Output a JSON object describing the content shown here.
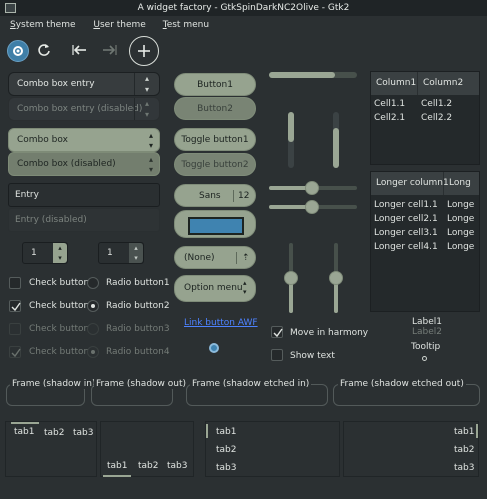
{
  "window": {
    "title": "A widget factory - GtkSpinDarkNC2Olive - Gtk2"
  },
  "menubar": {
    "items": [
      {
        "mnemonic": "S",
        "rest": "ystem theme"
      },
      {
        "mnemonic": "U",
        "rest": "ser theme"
      },
      {
        "mnemonic": "T",
        "rest": "est menu"
      }
    ]
  },
  "toolbar": {
    "icons": [
      "gear-icon",
      "refresh-icon",
      "back-arrow-icon",
      "forward-arrow-icon",
      "add-icon"
    ]
  },
  "combos": {
    "entry": "Combo box entry",
    "entry_disabled": "Combo box entry (disabled)",
    "box": "Combo box",
    "box_disabled": "Combo box (disabled)"
  },
  "entries": {
    "entry": "Entry",
    "entry_disabled": "Entry (disabled)"
  },
  "spins": {
    "spin1": "1",
    "spin2": "1"
  },
  "checks": [
    {
      "label": "Check button1",
      "checked": false,
      "disabled": false
    },
    {
      "label": "Check button2",
      "checked": true,
      "disabled": false
    },
    {
      "label": "Check button3",
      "checked": false,
      "disabled": true
    },
    {
      "label": "Check button4",
      "checked": true,
      "disabled": true
    }
  ],
  "radios": [
    {
      "label": "Radio button1",
      "selected": false,
      "disabled": false
    },
    {
      "label": "Radio button2",
      "selected": true,
      "disabled": false
    },
    {
      "label": "Radio button3",
      "selected": false,
      "disabled": true
    },
    {
      "label": "Radio button4",
      "selected": true,
      "disabled": true
    }
  ],
  "buttons": {
    "button1": "Button1",
    "button2": "Button2",
    "toggle1": "Toggle button1",
    "toggle2": "Toggle button2",
    "font_name": "Sans",
    "font_size": "12",
    "none": "(None)",
    "option_menu": "Option menu",
    "link": "Link button AWF"
  },
  "scales": {
    "move_in_harmony": "Move in harmony",
    "show_text": "Show text"
  },
  "tree1": {
    "columns": [
      "Column1",
      "Column2"
    ],
    "rows": [
      [
        "Cell1.1",
        "Cell1.2"
      ],
      [
        "Cell2.1",
        "Cell2.2"
      ]
    ]
  },
  "tree2": {
    "columns": [
      "Longer column1",
      "Long"
    ],
    "rows": [
      [
        "Longer cell1.1",
        "Longe"
      ],
      [
        "Longer cell2.1",
        "Longe"
      ],
      [
        "Longer cell3.1",
        "Longe"
      ],
      [
        "Longer cell4.1",
        "Longe"
      ]
    ]
  },
  "labels": {
    "label1": "Label1",
    "label2": "Label2",
    "tooltip": "Tooltip"
  },
  "frames": [
    "Frame (shadow in)",
    "Frame (shadow out)",
    "Frame (shadow etched in)",
    "Frame (shadow etched out)"
  ],
  "notebooks": {
    "nb1": [
      "tab1",
      "tab2",
      "tab3"
    ],
    "nb2": [
      "tab1",
      "tab2",
      "tab3"
    ],
    "nb3": [
      "tab1",
      "tab2",
      "tab3"
    ],
    "nb4": [
      "tab1",
      "tab2",
      "tab3"
    ]
  },
  "colors": {
    "accent": "#96a38f",
    "bg": "#2b3032",
    "titlebar": "#1f2426"
  }
}
